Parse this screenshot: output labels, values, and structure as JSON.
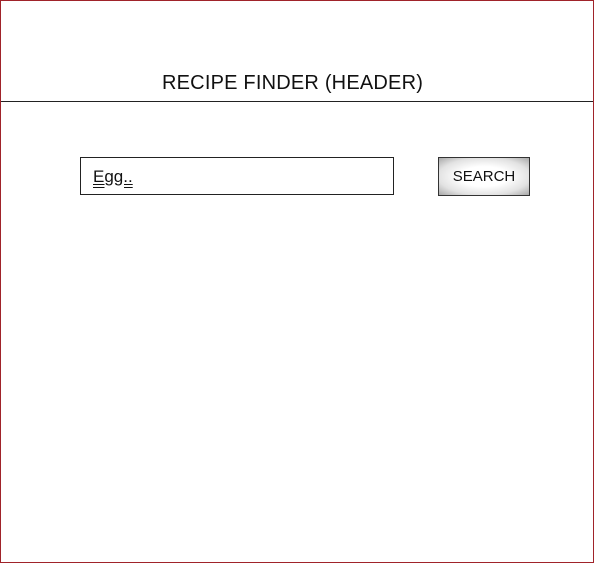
{
  "header": {
    "title": "RECIPE FINDER (HEADER)"
  },
  "search": {
    "value": "Egg..",
    "button_label": "SEARCH"
  },
  "colors": {
    "frame_border": "#a0232a",
    "divider": "#222222",
    "text": "#111111"
  }
}
